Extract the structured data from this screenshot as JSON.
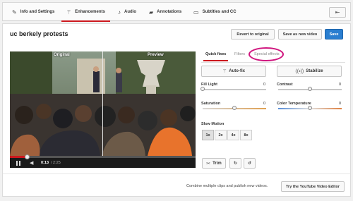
{
  "tabs": [
    {
      "label": "Info and Settings",
      "icon": "pencil-icon"
    },
    {
      "label": "Enhancements",
      "icon": "magic-wand-icon"
    },
    {
      "label": "Audio",
      "icon": "music-note-icon"
    },
    {
      "label": "Annotations",
      "icon": "speech-bubble-icon"
    },
    {
      "label": "Subtitles and CC",
      "icon": "cc-icon"
    }
  ],
  "back_icon": "back-arrow-icon",
  "video_title": "uc berkely protests",
  "actions": {
    "revert": "Revert to original",
    "save_new": "Save as new video",
    "save": "Save"
  },
  "player": {
    "original_label": "Original",
    "preview_label": "Preview",
    "current_time": "0:13",
    "total_time": "/ 2:25",
    "progress": 0.09
  },
  "fx_tabs": [
    "Quick fixes",
    "Filters",
    "Special effects"
  ],
  "auto_fix": "Auto-fix",
  "stabilize": "Stabilize",
  "sliders": [
    {
      "label": "Fill Light",
      "value": "0",
      "level": 0.0
    },
    {
      "label": "Contrast",
      "value": "0",
      "level": 0.5
    },
    {
      "label": "Saturation",
      "value": "0",
      "level": 0.5
    },
    {
      "label": "Color Temperature",
      "value": "0",
      "level": 0.5
    }
  ],
  "slow_motion": {
    "label": "Slow Motion",
    "options": [
      "1x",
      "2x",
      "4x",
      "8x"
    ],
    "selected": "1x"
  },
  "trim_label": "Trim",
  "footer": {
    "text": "Combine multiple clips and publish new videos.",
    "button": "Try the YouTube Video Editor"
  },
  "colors": {
    "accent": "#cc181e",
    "primary": "#2a7ed0",
    "highlight_circle": "#d0177f"
  }
}
